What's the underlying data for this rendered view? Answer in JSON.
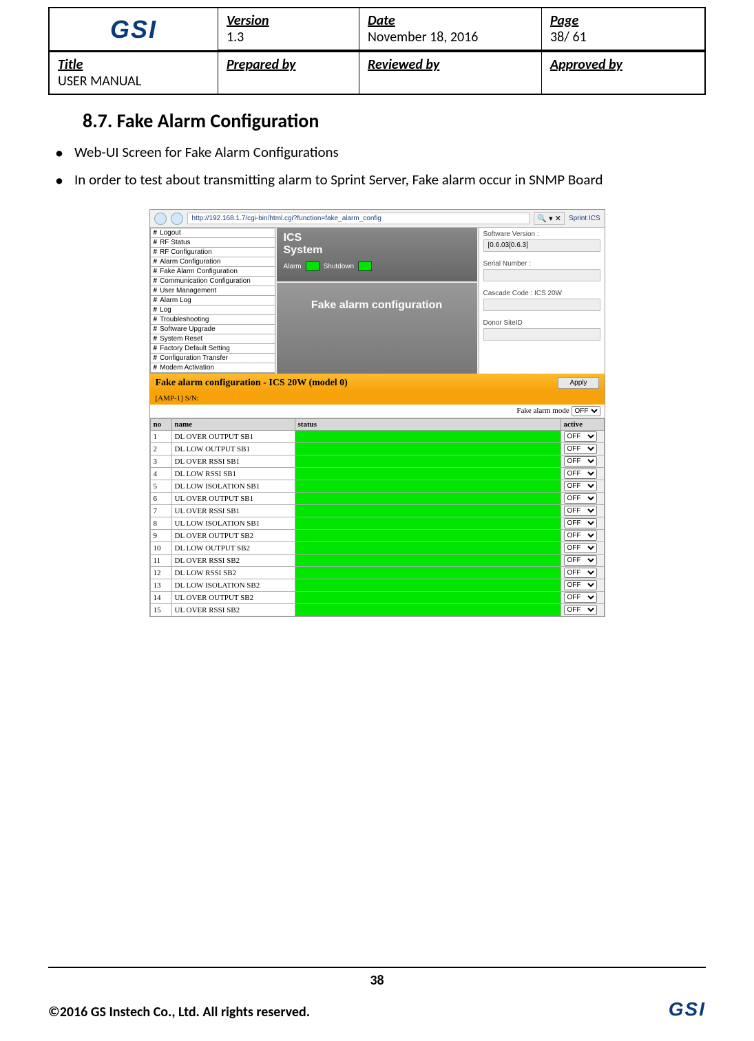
{
  "header": {
    "logo": "GSI",
    "version_label": "Version",
    "version": "1.3",
    "date_label": "Date",
    "date": "November 18, 2016",
    "page_label": "Page",
    "page": "38/ 61",
    "title_label": "Title",
    "title": "USER MANUAL",
    "prepared_by_label": "Prepared by",
    "reviewed_by_label": "Reviewed by",
    "approved_by_label": "Approved by"
  },
  "section": {
    "heading": "8.7.  Fake Alarm Configuration",
    "bullet1": "Web-UI Screen for Fake Alarm Configurations",
    "bullet2": "In order to test about transmitting alarm to Sprint Server, Fake alarm occur in SNMP Board"
  },
  "browser": {
    "url": "http://192.168.1.7/cgi-bin/html.cgi?function=fake_alarm_config",
    "site": "Sprint ICS"
  },
  "sidebar": [
    "Logout",
    "RF Status",
    "RF Configuration",
    "Alarm Configuration",
    "Fake Alarm Configuration",
    "Communication Configuration",
    "User Management",
    "Alarm Log",
    "Log",
    "Troubleshooting",
    "Software Upgrade",
    "System Reset",
    "Factory Default Setting",
    "Configuration Transfer",
    "Modem Activation"
  ],
  "ics": {
    "title1": "ICS",
    "title2": "System",
    "alarm_label": "Alarm",
    "shutdown_label": "Shutdown"
  },
  "panel_title": "Fake alarm configuration",
  "info": {
    "sw_label": "Software Version :",
    "sw_value": "[0.6.03[0.6.3]",
    "sn_label": "Serial Number :",
    "sn_value": "",
    "cascade_label": "Cascade Code : ICS 20W",
    "cascade_value": "",
    "donor_label": "Donor SiteID",
    "donor_value": ""
  },
  "config": {
    "title": "Fake alarm configuration - ICS 20W (model 0)",
    "apply": "Apply",
    "amp": "[AMP-1] S/N:",
    "mode_label": "Fake alarm mode",
    "mode_value": "OFF",
    "th_no": "no",
    "th_name": "name",
    "th_status": "status",
    "th_active": "active"
  },
  "alarms": [
    {
      "no": "1",
      "name": "DL OVER OUTPUT SB1",
      "active": "OFF"
    },
    {
      "no": "2",
      "name": "DL LOW OUTPUT SB1",
      "active": "OFF"
    },
    {
      "no": "3",
      "name": "DL OVER RSSI SB1",
      "active": "OFF"
    },
    {
      "no": "4",
      "name": "DL LOW RSSI SB1",
      "active": "OFF"
    },
    {
      "no": "5",
      "name": "DL LOW ISOLATION SB1",
      "active": "OFF"
    },
    {
      "no": "6",
      "name": "UL OVER OUTPUT SB1",
      "active": "OFF"
    },
    {
      "no": "7",
      "name": "UL OVER RSSI SB1",
      "active": "OFF"
    },
    {
      "no": "8",
      "name": "UL LOW ISOLATION SB1",
      "active": "OFF"
    },
    {
      "no": "9",
      "name": "DL OVER OUTPUT SB2",
      "active": "OFF"
    },
    {
      "no": "10",
      "name": "DL LOW OUTPUT SB2",
      "active": "OFF"
    },
    {
      "no": "11",
      "name": "DL OVER RSSI SB2",
      "active": "OFF"
    },
    {
      "no": "12",
      "name": "DL LOW RSSI SB2",
      "active": "OFF"
    },
    {
      "no": "13",
      "name": "DL LOW ISOLATION SB2",
      "active": "OFF"
    },
    {
      "no": "14",
      "name": "UL OVER OUTPUT SB2",
      "active": "OFF"
    },
    {
      "no": "15",
      "name": "UL OVER RSSI SB2",
      "active": "OFF"
    }
  ],
  "footer": {
    "page": "38",
    "copy": "©2016 GS Instech Co., Ltd.    All rights reserved.",
    "logo": "GSI"
  }
}
